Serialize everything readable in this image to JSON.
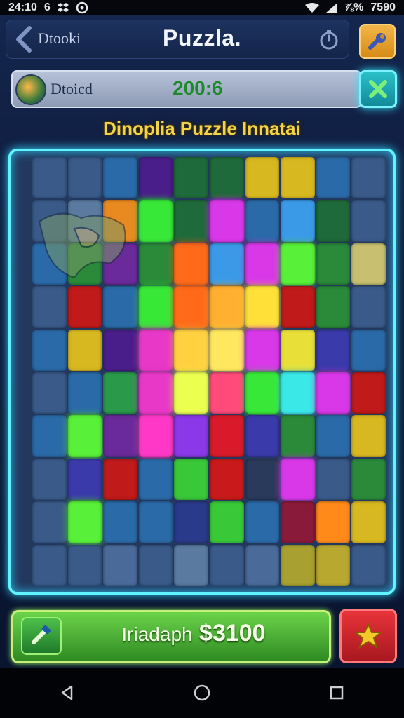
{
  "status_bar": {
    "time": "24:10",
    "secondary": "6",
    "right_text": "⅞% ",
    "battery": "7590",
    "icons": [
      "dropbox-icon",
      "sync-icon",
      "wifi-icon",
      "signal-icon"
    ]
  },
  "header": {
    "back_label": "Dtooki",
    "title": "Puzzla.",
    "timer_icon": "timer-icon",
    "hint_icon": "wrench-icon"
  },
  "info_bar": {
    "player_name": "Dtoicd",
    "score": "200:6",
    "close_icon": "close-icon"
  },
  "puzzle": {
    "title": "Dinoplia Puzzle Innatai",
    "rows": 10,
    "cols": 10,
    "colors": [
      "#3a5a8a",
      "#3a5a8a",
      "#2a6aa8",
      "#4a1e8a",
      "#1f6a3a",
      "#1f6a3a",
      "#d8b820",
      "#d8b820",
      "#2a6aa8",
      "#3a5a8a",
      "#3a5a8a",
      "#5a7aa0",
      "#e88a20",
      "#38e838",
      "#1f6a3a",
      "#d838e8",
      "#2a6aa8",
      "#3a9ae8",
      "#1f6a3a",
      "#3a5a8a",
      "#2a6aa8",
      "#2a8a3a",
      "#6a2a9a",
      "#2a8a3a",
      "#ff6a1a",
      "#3a9ae8",
      "#d838e8",
      "#58f038",
      "#2a8a3a",
      "#c8c070",
      "#3a5a8a",
      "#c01a1a",
      "#2a6aa8",
      "#38e838",
      "#ff6a1a",
      "#ffb030",
      "#ffe038",
      "#c01a1a",
      "#2a8a3a",
      "#3a5a8a",
      "#2a6aa8",
      "#d8b820",
      "#4a1e8a",
      "#e838c8",
      "#ffd040",
      "#ffe860",
      "#d838e8",
      "#e8e038",
      "#3a3aaa",
      "#2a6aa8",
      "#3a5a8a",
      "#2a6aa8",
      "#2a9a4a",
      "#e838c8",
      "#eaff50",
      "#ff4a7a",
      "#38e838",
      "#3ae8e8",
      "#d838e8",
      "#c01a1a",
      "#2a6aa8",
      "#58f038",
      "#6a2a9a",
      "#ff38c8",
      "#8a38e8",
      "#d81a2a",
      "#3a3aaa",
      "#2a8a3a",
      "#2a6aa8",
      "#d8b820",
      "#3a5a8a",
      "#3a3aaa",
      "#c01a1a",
      "#2a6aa8",
      "#38c838",
      "#c81a1a",
      "#2a3a5a",
      "#d838e8",
      "#3a5a8a",
      "#2a8a3a",
      "#3a5a8a",
      "#58f038",
      "#2a6aa8",
      "#2a6aa8",
      "#2a3a8a",
      "#38c838",
      "#2a6aa8",
      "#8a1a3a",
      "#ff8a1a",
      "#d8b820",
      "#3a5a8a",
      "#3a5a8a",
      "#4a6a9a",
      "#3a5a8a",
      "#5a7aa0",
      "#3a5a8a",
      "#4a6a9a",
      "#a8a030",
      "#b8a830",
      "#3a5a8a"
    ]
  },
  "bottom": {
    "label": "Iriadaph",
    "amount": "$3100",
    "left_icon": "hammer-icon",
    "star_icon": "star-icon"
  },
  "nav": {
    "back_icon": "nav-back-icon",
    "home_icon": "nav-home-icon",
    "recents_icon": "nav-recents-icon"
  }
}
